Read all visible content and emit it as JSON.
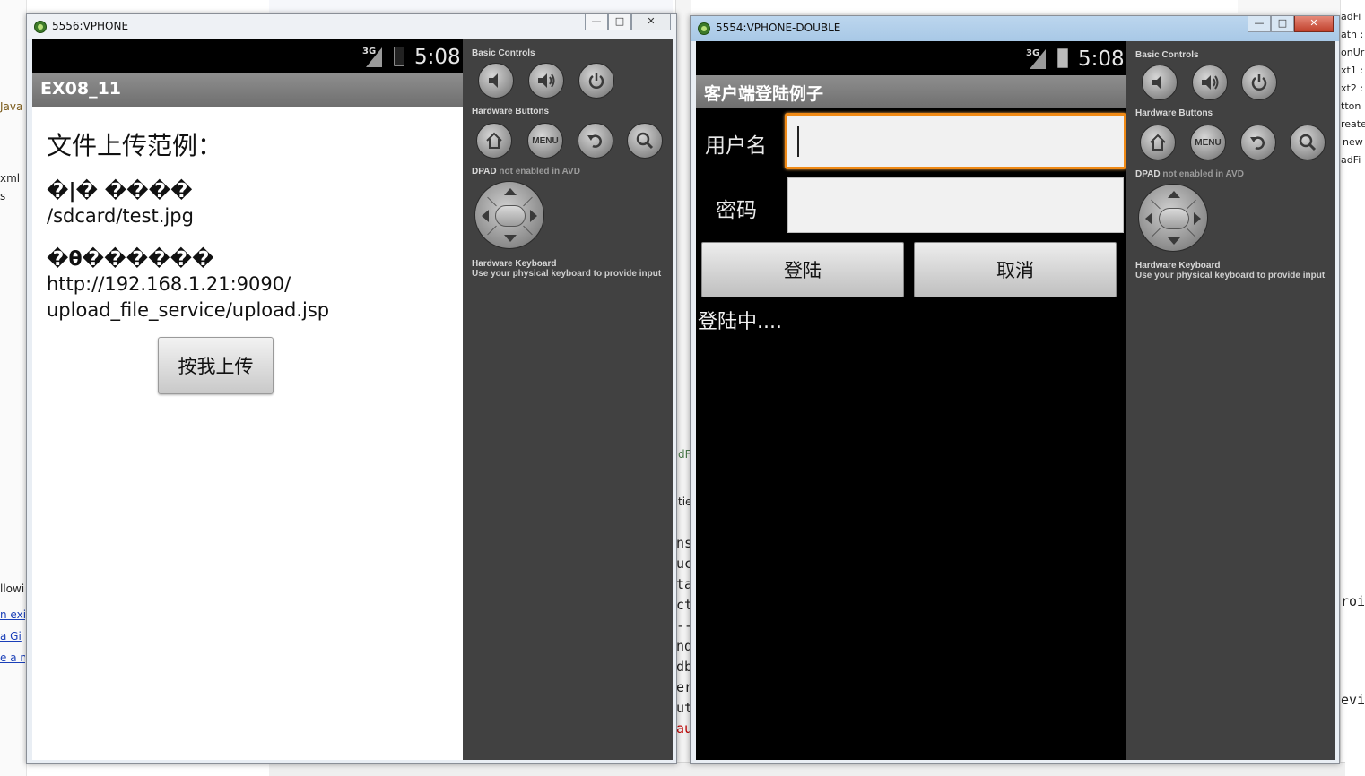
{
  "background": {
    "left_fragments": [
      "Java",
      "xml",
      "s",
      "llowi",
      "n exi",
      "a Gi",
      "e a n"
    ],
    "right_fragments": [
      "adFi",
      "ath :",
      "onUr",
      "xt1 :",
      "xt2 :",
      "tton",
      "reate",
      "new",
      "adFi",
      "roi",
      "evi"
    ],
    "mid_fragments": [
      "dF",
      "tie",
      "ns",
      "uc",
      "ta",
      "ct",
      "--",
      "nd",
      "db",
      "er",
      "ut",
      "au"
    ]
  },
  "window1": {
    "title": "5556:VPHONE",
    "status": {
      "network": "3G",
      "time": "5:08"
    },
    "app_title": "EX08_11",
    "heading": "文件上传范例：",
    "file_label": "�|� ����",
    "file_path": "/sdcard/test.jpg",
    "url_label": "�θ������",
    "url_line1": "http://192.168.1.21:9090/",
    "url_line2": "upload_file_service/upload.jsp",
    "upload_button": "按我上传"
  },
  "window2": {
    "title": "5554:VPHONE-DOUBLE",
    "status": {
      "network": "3G",
      "time": "5:08"
    },
    "app_title": "客户端登陆例子",
    "username_label": "用户名",
    "username_value": "",
    "password_label": "密码",
    "password_value": "",
    "login_button": "登陆",
    "cancel_button": "取消",
    "status_text": "登陆中...."
  },
  "controls": {
    "basic_controls": "Basic Controls",
    "hardware_buttons": "Hardware Buttons",
    "dpad": "DPAD",
    "dpad_note": "not enabled in AVD",
    "keyboard_title": "Hardware Keyboard",
    "keyboard_note": "Use your physical keyboard to provide input",
    "menu_label": "MENU"
  },
  "colors": {
    "focus_border": "#f08a16",
    "skin": "#414141",
    "appbar": "#7f7f7f"
  }
}
